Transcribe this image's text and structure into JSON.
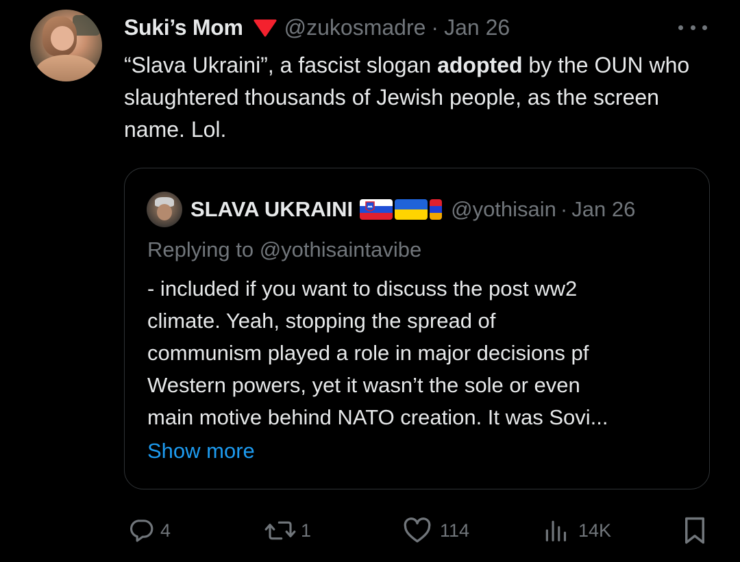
{
  "tweet": {
    "author_name": "Suki’s Mom",
    "handle": "@zukosmadre",
    "separator": "·",
    "date": "Jan 26",
    "text_part1": "“Slava Ukraini”, a fascist slogan ",
    "text_bold": "adopted",
    "text_part2": " by the OUN who slaughtered thousands of Jewish people, as the screen name. Lol."
  },
  "quoted": {
    "author_name": "SLAVA UKRAINI",
    "handle": "@yothisain",
    "separator": "·",
    "date": "Jan 26",
    "replying_to": "Replying to @yothisaintavibe",
    "body_lines": [
      "- included if you want to discuss the post ww2",
      "climate. Yeah, stopping the spread of",
      "communism played a role in major decisions pf",
      "Western powers, yet it wasn’t the sole or even",
      "main motive behind NATO creation. It was Sovi..."
    ],
    "show_more": "Show more"
  },
  "actions": {
    "replies": "4",
    "reposts": "1",
    "likes": "114",
    "views": "14K"
  },
  "icons": {
    "badge": "red-triangle-icon",
    "more": "more-dots-icon",
    "reply": "reply-icon",
    "repost": "repost-icon",
    "like": "heart-icon",
    "views": "views-icon",
    "bookmark": "bookmark-icon"
  },
  "colors": {
    "background": "#000000",
    "text": "#e7e9ea",
    "secondary": "#71767b",
    "link": "#1d9bf0",
    "badge": "#f4212e",
    "border": "#2f3336"
  }
}
